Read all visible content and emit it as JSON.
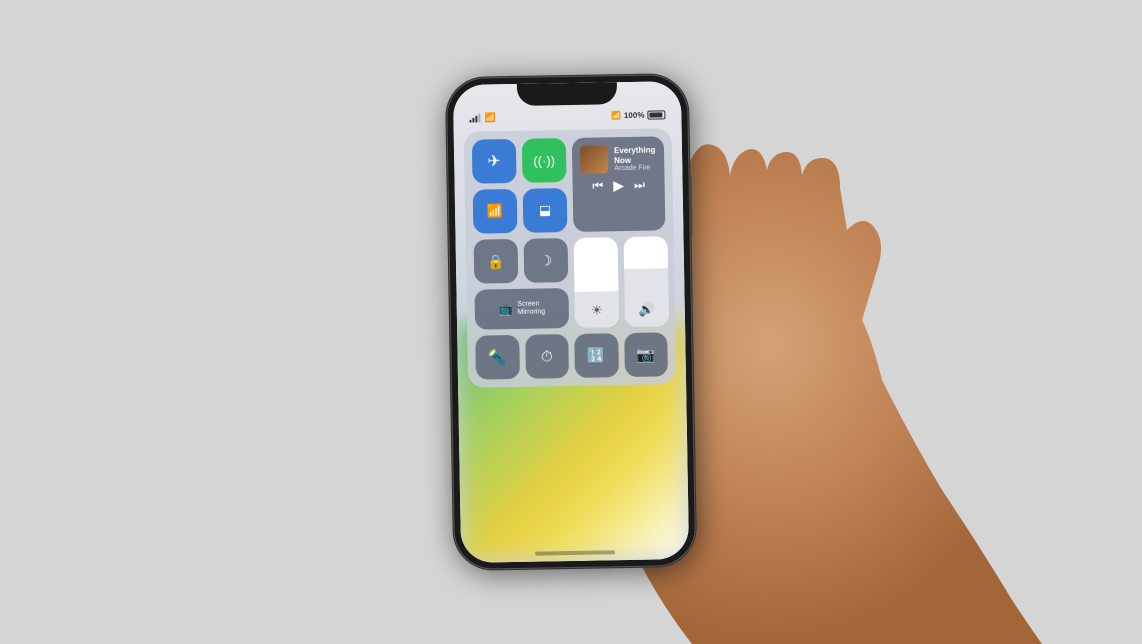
{
  "scene": {
    "bg_color": "#d5d5d5"
  },
  "status_bar": {
    "time": "",
    "signal_label": "signal",
    "wifi_label": "wifi",
    "battery_percent": "100%",
    "bluetooth_label": "bluetooth"
  },
  "now_playing": {
    "title": "Everything Now",
    "artist": "Arcade Fire"
  },
  "control_center": {
    "airplane_mode": "✈",
    "cellular": "📶",
    "wifi": "wifi",
    "bluetooth": "bluetooth",
    "rewind": "⏮",
    "play": "▶",
    "fast_forward": "⏭",
    "rotation_lock": "🔒",
    "do_not_disturb": "moon",
    "screen_mirroring_label": "Screen\nMirroring",
    "screen_mirroring_icon": "📺",
    "brightness_icon": "☀",
    "volume_icon": "🔊",
    "flashlight_icon": "flashlight",
    "timer_icon": "timer",
    "calculator_icon": "calculator",
    "camera_icon": "camera"
  }
}
